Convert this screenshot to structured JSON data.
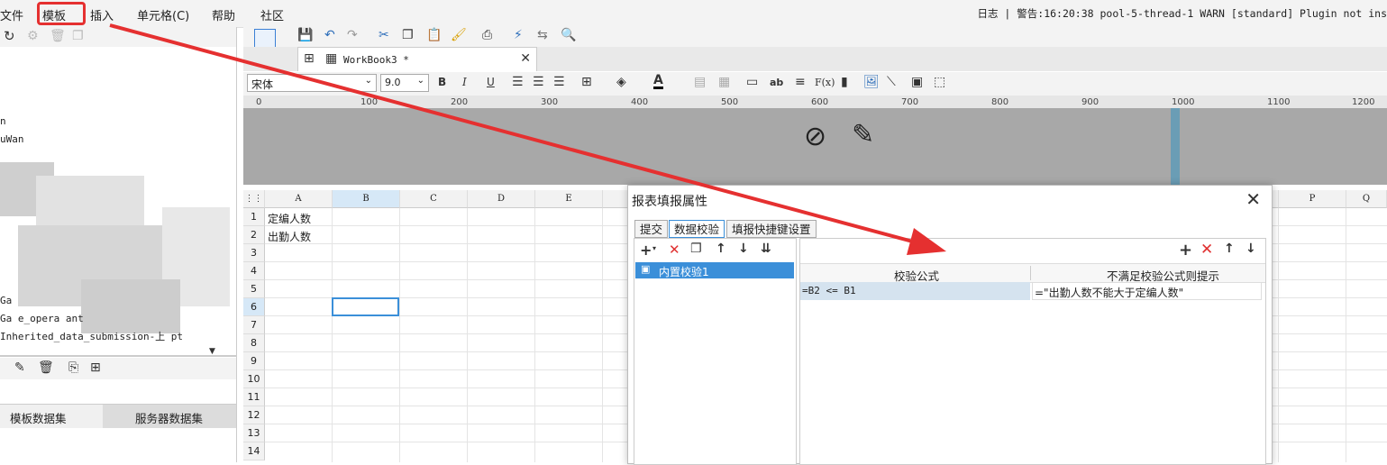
{
  "menu": {
    "file": "文件",
    "template": "模板",
    "insert": "插入",
    "cell": "单元格(C)",
    "help": "帮助",
    "community": "社区"
  },
  "log": "日志 | 警告:16:20:38 pool-5-thread-1 WARN [standard] Plugin not ins",
  "left_panel": {
    "tree_items": [
      "n",
      "uWan",
      "Ga",
      "Ga      e_opera       ant",
      "Inherited_data_submission-上        pt"
    ],
    "dataset_tabs": [
      "模板数据集",
      "服务器数据集"
    ]
  },
  "workbook_tab": "WorkBook3 *",
  "format_bar": {
    "font": "宋体",
    "size": "9.0",
    "bold": "B",
    "italic": "I",
    "underline": "U",
    "ab": "ab",
    "fx": "F(x)"
  },
  "ruler_ticks": [
    "0",
    "100",
    "200",
    "300",
    "400",
    "500",
    "600",
    "700",
    "800",
    "900",
    "1000",
    "1100",
    "1200"
  ],
  "grid": {
    "columns": [
      "A",
      "B",
      "C",
      "D",
      "E",
      "P",
      "Q"
    ],
    "rows": [
      "1",
      "2",
      "3",
      "4",
      "5",
      "6",
      "7",
      "8",
      "9",
      "10",
      "11",
      "12",
      "13",
      "14"
    ],
    "cells": {
      "A1": "定编人数",
      "A2": "出勤人数"
    }
  },
  "dialog": {
    "title": "报表填报属性",
    "close": "✕",
    "tabs": [
      "提交",
      "数据校验",
      "填报快捷键设置"
    ],
    "rule_name": "内置校验1",
    "col_formula": "校验公式",
    "col_message": "不满足校验公式则提示",
    "formula": "=B2 <= B1",
    "message": "=\"出勤人数不能大于定编人数\""
  },
  "colors": {
    "highlight_box": "#e53030",
    "arrow": "#e53030",
    "selection": "#3b8fd9"
  }
}
